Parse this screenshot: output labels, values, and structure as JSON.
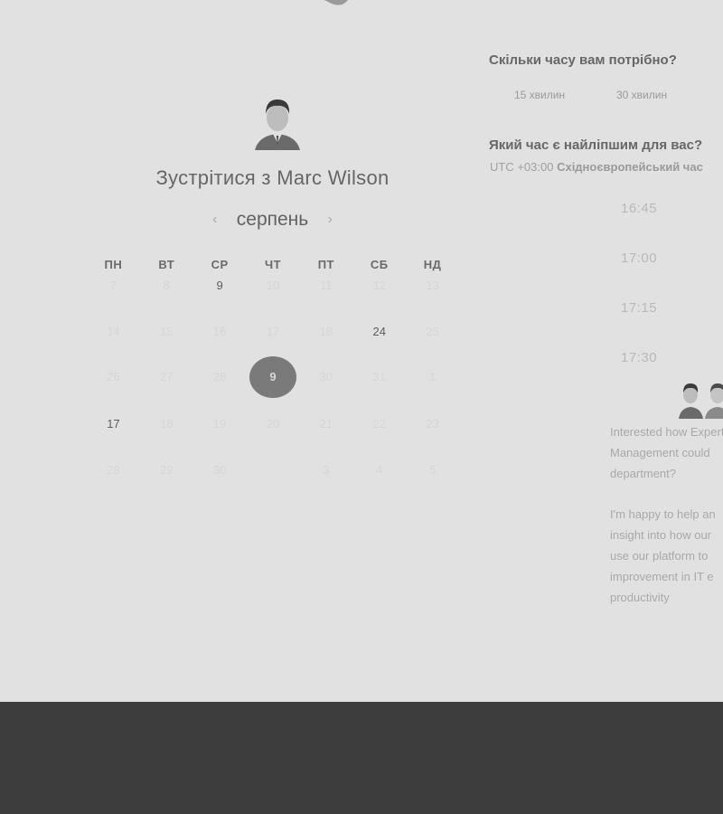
{
  "booking": {
    "title": "Зустрітися з Marc Wilson",
    "month": "серпень",
    "prev_arrow": "‹",
    "next_arrow": "›"
  },
  "calendar": {
    "weekdays": [
      "ПН",
      "ВТ",
      "СР",
      "ЧТ",
      "ПТ",
      "СБ",
      "НД"
    ],
    "weeks": [
      [
        {
          "t": "7",
          "s": "faded"
        },
        {
          "t": "8",
          "s": "faded"
        },
        {
          "t": "9",
          "s": "active"
        },
        {
          "t": "10",
          "s": "faded"
        },
        {
          "t": "11",
          "s": "faded"
        },
        {
          "t": "12",
          "s": "faded"
        },
        {
          "t": "13",
          "s": "faded"
        }
      ],
      [
        {
          "t": "14",
          "s": "faded"
        },
        {
          "t": "15",
          "s": "faded"
        },
        {
          "t": "16",
          "s": "faded"
        },
        {
          "t": "17",
          "s": "faded"
        },
        {
          "t": "18",
          "s": "faded"
        },
        {
          "t": "24",
          "s": "active"
        },
        {
          "t": "25",
          "s": "faded"
        }
      ],
      [
        {
          "t": "26",
          "s": "faded"
        },
        {
          "t": "27",
          "s": "faded"
        },
        {
          "t": "28",
          "s": "faded"
        },
        {
          "t": "9",
          "s": "sel"
        },
        {
          "t": "30",
          "s": "faded"
        },
        {
          "t": "31",
          "s": "faded"
        },
        {
          "t": "1",
          "s": "faded"
        }
      ],
      [
        {
          "t": "17",
          "s": "active"
        },
        {
          "t": "18",
          "s": "faded"
        },
        {
          "t": "19",
          "s": "faded"
        },
        {
          "t": "20",
          "s": "faded"
        },
        {
          "t": "21",
          "s": "faded"
        },
        {
          "t": "22",
          "s": "faded"
        },
        {
          "t": "23",
          "s": "faded"
        }
      ],
      [
        {
          "t": "28",
          "s": "faded"
        },
        {
          "t": "29",
          "s": "faded"
        },
        {
          "t": "30",
          "s": "faded"
        },
        {
          "t": "",
          "s": "faded"
        },
        {
          "t": "3",
          "s": "faded"
        },
        {
          "t": "4",
          "s": "faded"
        },
        {
          "t": "5",
          "s": "faded"
        }
      ]
    ]
  },
  "duration": {
    "question": "Скільки часу вам потрібно?",
    "options": [
      "15 хвилин",
      "30 хвилин"
    ]
  },
  "time": {
    "question": "Який час є найліпшим для вас?",
    "timezone_offset": "UTC +03:00",
    "timezone_name": "Східноєвропейський час",
    "slots": [
      "16:45",
      "17:00",
      "17:15",
      "17:30"
    ]
  },
  "description": {
    "p1": "Interested how Expert\nManagement could\ndepartment?",
    "p2": "I'm happy to help an\ninsight into how our\nuse our platform to\nimprovement in IT e\nproductivity"
  },
  "icons": {
    "logo": "logo-shape-icon",
    "avatar": "avatar-icon",
    "team_avatars": "avatar-pair-icon"
  },
  "colors": {
    "background": "#e1e1e1",
    "footer": "#3d3d3d",
    "selected_day": "#7a7a7a"
  }
}
